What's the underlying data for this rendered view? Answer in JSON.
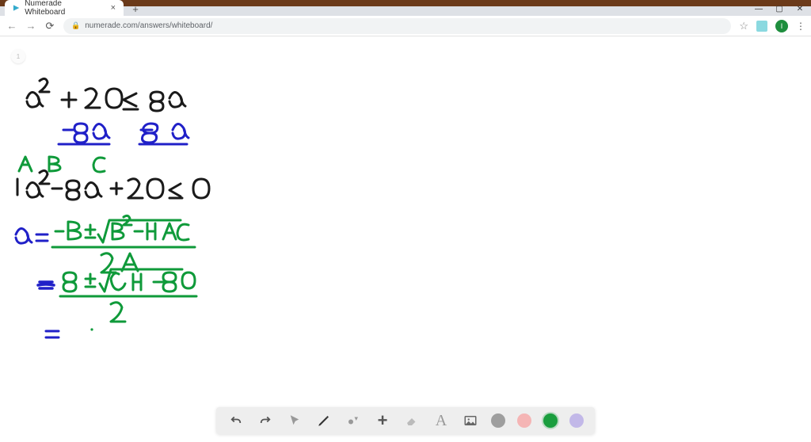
{
  "browser": {
    "tab_title": "Numerade Whiteboard",
    "url": "numerade.com/answers/whiteboard/",
    "avatar_initial": "I",
    "close_glyph": "×",
    "newtab_glyph": "+"
  },
  "whiteboard": {
    "small_circle_label": "1",
    "strokes": {
      "black_ink": "#1a1a1a",
      "blue_ink": "#2020c8",
      "green_ink": "#0f9a3a"
    },
    "math_lines": [
      "a² + 20 ≤ 8a",
      "−8a    −8a",
      "A   B     C",
      "1a² − 8a + 20  ≤ 0",
      "a = (−B ± √(B² − 4AC)) / 2A",
      "= (8 ± √(64 − 80)) / 2",
      "="
    ]
  },
  "toolbar": {
    "undo": "↶",
    "redo": "↷",
    "pointer": "pointer",
    "pen": "pen",
    "shapes": "shapes",
    "plus": "+",
    "eraser": "eraser",
    "text": "A",
    "image": "image"
  }
}
